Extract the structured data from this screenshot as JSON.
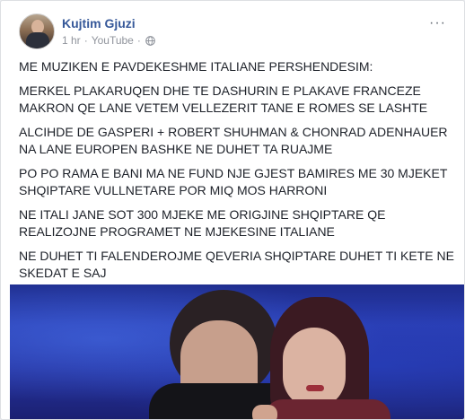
{
  "post": {
    "author": "Kujtim Gjuzi",
    "time": "1 hr",
    "separator1": "·",
    "source": "YouTube",
    "separator2": "·",
    "privacy_icon": "globe-icon",
    "more_icon": "more-options-icon",
    "more_glyph": "···",
    "paragraphs": [
      "ME MUZIKEN E PAVDEKESHME ITALIANE PERSHENDESIM:",
      "MERKEL PLAKARUQEN DHE TE DASHURIN E PLAKAVE FRANCEZE MAKRON QE LANE VETEM VELLEZERIT TANE E ROMES SE LASHTE",
      "ALCIHDE DE GASPERI + ROBERT SHUHMAN & CHONRAD ADENHAUER NA LANE EUROPEN BASHKE NE DUHET TA RUAJME",
      "PO PO RAMA E BANI MA NE FUND NJE GJEST BAMIRES ME 30 MJEKET SHQIPTARE VULLNETARE POR MIQ MOS HARRONI",
      "NE ITALI JANE SOT 300 MJEKE ME ORIGJINE SHQIPTARE QE REALIZOJNE PROGRAMET NE MJEKESINE ITALIANE",
      "NE DUHET TI FALENDEROJME QEVERIA SHQIPTARE DUHET TI KETE NE SKEDAT E SAJ"
    ]
  },
  "colors": {
    "author_link": "#365899",
    "meta_text": "#90949c",
    "body_text": "#1d2129"
  }
}
